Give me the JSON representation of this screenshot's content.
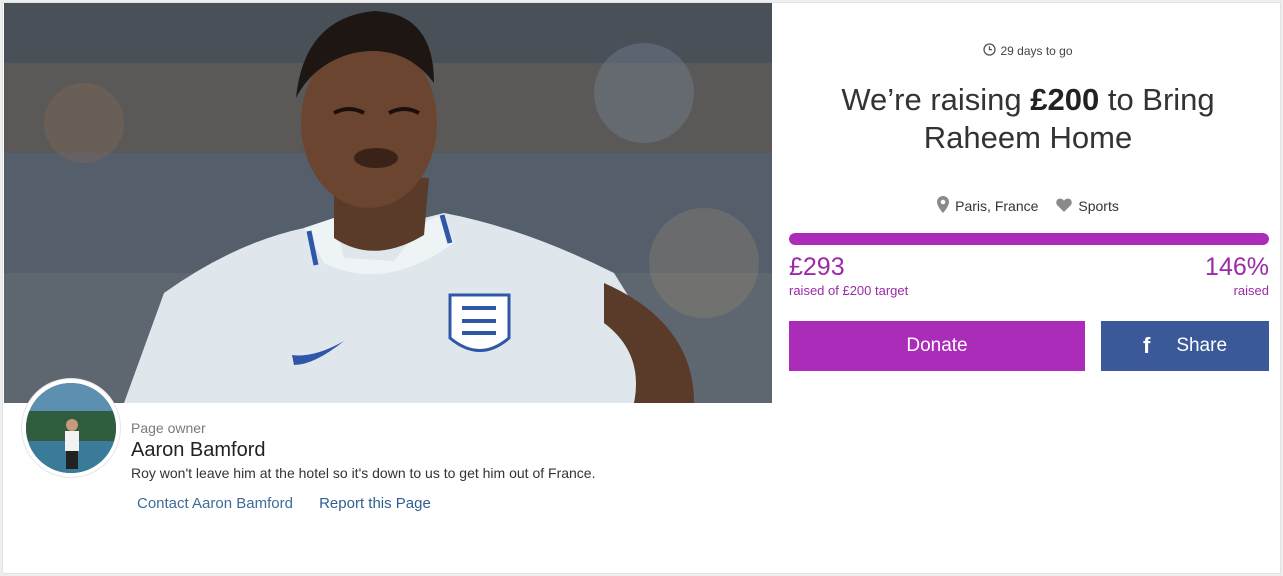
{
  "campaign": {
    "days_left": "29 days to go",
    "title_pre": "We’re raising ",
    "title_amount": "£200",
    "title_post": " to Bring Raheem Home",
    "location": "Paris, France",
    "category": "Sports",
    "progress_fraction": 1.0,
    "raised_amount": "£293",
    "raised_sub": "raised of £200 target",
    "percent": "146%",
    "percent_sub": "raised"
  },
  "actions": {
    "donate_label": "Donate",
    "share_label": "Share"
  },
  "owner": {
    "kicker": "Page owner",
    "name": "Aaron Bamford",
    "description": "Roy won't leave him at the hotel so it's down to us to get him out of France.",
    "contact_label": "Contact Aaron Bamford",
    "report_label": "Report this Page"
  },
  "colors": {
    "accent": "#ab2cb8",
    "facebook": "#3b5998",
    "link": "#3d6c99"
  },
  "icons": {
    "clock": "clock-icon",
    "location": "map-pin-icon",
    "category": "heart-icon",
    "share": "facebook-icon"
  }
}
